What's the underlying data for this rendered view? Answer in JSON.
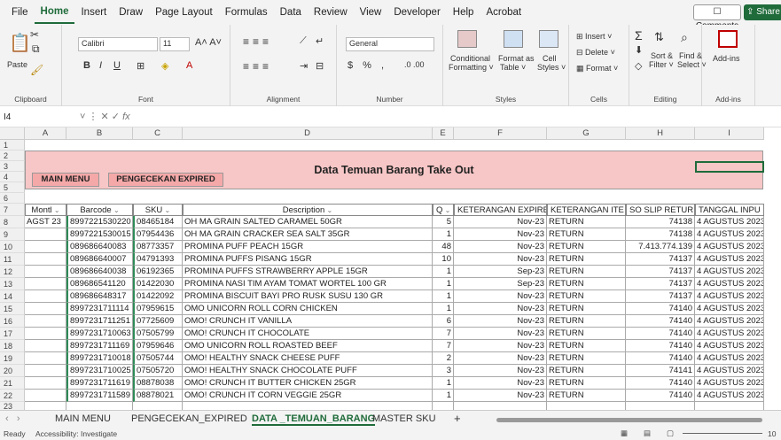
{
  "menu_tabs": [
    "File",
    "Home",
    "Insert",
    "Draw",
    "Page Layout",
    "Formulas",
    "Data",
    "Review",
    "View",
    "Developer",
    "Help",
    "Acrobat"
  ],
  "active_tab": "Home",
  "comments_label": "Comments",
  "share_label": "Share",
  "ribbon": {
    "clipboard": {
      "label": "Clipboard",
      "paste": "Paste"
    },
    "font": {
      "label": "Font",
      "name": "Calibri",
      "size": "11"
    },
    "alignment": {
      "label": "Alignment"
    },
    "number": {
      "label": "Number",
      "format": "General"
    },
    "styles": {
      "label": "Styles",
      "conditional": "Conditional",
      "conditional2": "Formatting ˅",
      "format_as": "Format as",
      "format_as2": "Table ˅",
      "cell": "Cell",
      "cell2": "Styles ˅"
    },
    "cells": {
      "label": "Cells",
      "insert": "Insert",
      "delete": "Delete",
      "format": "Format"
    },
    "editing": {
      "label": "Editing",
      "sort": "Sort &",
      "sort2": "Filter ˅",
      "find": "Find &",
      "find2": "Select ˅"
    },
    "addins": {
      "label": "Add-ins",
      "btn": "Add-ins"
    }
  },
  "name_box": "I4",
  "fx_label": "fx",
  "columns": [
    "A",
    "B",
    "C",
    "D",
    "E",
    "F",
    "G",
    "H",
    "I"
  ],
  "title": "Data Temuan Barang Take Out",
  "main_menu_btn": "MAIN MENU",
  "expired_btn": "PENGECEKAN EXPIRED",
  "headers": [
    "Montl",
    "Barcode",
    "SKU",
    "Description",
    "Q",
    "KETERANGAN EXPIRE",
    "KETERANGAN ITE",
    "SO SLIP RETUR",
    "TANGGAL INPU"
  ],
  "rows": [
    [
      "AGST 23",
      "8997221530220",
      "08465184",
      "OH MA GRAIN SALTED CARAMEL 50GR",
      "5",
      "Nov-23",
      "RETURN",
      "74138",
      "4 AGUSTUS 2023"
    ],
    [
      "",
      "8997221530015",
      "07954436",
      "OH MA GRAIN CRACKER SEA SALT 35GR",
      "1",
      "Nov-23",
      "RETURN",
      "74138",
      "4 AGUSTUS 2023"
    ],
    [
      "",
      "089686640083",
      "08773357",
      "PROMINA PUFF PEACH 15GR",
      "48",
      "Nov-23",
      "RETURN",
      "7.413.774.139",
      "4 AGUSTUS 2023"
    ],
    [
      "",
      "089686640007",
      "04791393",
      "PROMINA PUFFS PISANG 15GR",
      "10",
      "Nov-23",
      "RETURN",
      "74137",
      "4 AGUSTUS 2023"
    ],
    [
      "",
      "089686640038",
      "06192365",
      "PROMINA PUFFS STRAWBERRY APPLE 15GR",
      "1",
      "Sep-23",
      "RETURN",
      "74137",
      "4 AGUSTUS 2023"
    ],
    [
      "",
      "089686541120",
      "01422030",
      "PROMINA NASI TIM AYAM TOMAT WORTEL 100 GR",
      "1",
      "Sep-23",
      "RETURN",
      "74137",
      "4 AGUSTUS 2023"
    ],
    [
      "",
      "089686648317",
      "01422092",
      "PROMINA BISCUIT BAYI PRO RUSK SUSU 130 GR",
      "1",
      "Nov-23",
      "RETURN",
      "74137",
      "4 AGUSTUS 2023"
    ],
    [
      "",
      "8997231711114",
      "07959615",
      "OMO UNICORN ROLL CORN CHICKEN",
      "1",
      "Nov-23",
      "RETURN",
      "74140",
      "4 AGUSTUS 2023"
    ],
    [
      "",
      "8997231711251",
      "07725609",
      "OMO! CRUNCH IT VANILLA",
      "6",
      "Nov-23",
      "RETURN",
      "74140",
      "4 AGUSTUS 2023"
    ],
    [
      "",
      "8997231710063",
      "07505799",
      "OMO! CRUNCH IT CHOCOLATE",
      "7",
      "Nov-23",
      "RETURN",
      "74140",
      "4 AGUSTUS 2023"
    ],
    [
      "",
      "8997231711169",
      "07959646",
      "OMO UNICORN ROLL ROASTED BEEF",
      "7",
      "Nov-23",
      "RETURN",
      "74140",
      "4 AGUSTUS 2023"
    ],
    [
      "",
      "8997231710018",
      "07505744",
      "OMO! HEALTHY SNACK CHEESE PUFF",
      "2",
      "Nov-23",
      "RETURN",
      "74140",
      "4 AGUSTUS 2023"
    ],
    [
      "",
      "8997231710025",
      "07505720",
      "OMO! HEALTHY SNACK CHOCOLATE PUFF",
      "3",
      "Nov-23",
      "RETURN",
      "74141",
      "4 AGUSTUS 2023"
    ],
    [
      "",
      "8997231711619",
      "08878038",
      "OMO! CRUNCH IT BUTTER CHICKEN 25GR",
      "1",
      "Nov-23",
      "RETURN",
      "74140",
      "4 AGUSTUS 2023"
    ],
    [
      "",
      "8997231711589",
      "08878021",
      "OMO! CRUNCH IT CORN VEGGIE 25GR",
      "1",
      "Nov-23",
      "RETURN",
      "74140",
      "4 AGUSTUS 2023"
    ]
  ],
  "sheet_tabs": [
    "MAIN MENU",
    "PENGECEKAN_EXPIRED",
    "DATA _TEMUAN_BARANG",
    "MASTER SKU"
  ],
  "active_sheet": "DATA _TEMUAN_BARANG",
  "status": {
    "ready": "Ready",
    "accessibility": "Accessibility: Investigate",
    "zoom": "10"
  }
}
